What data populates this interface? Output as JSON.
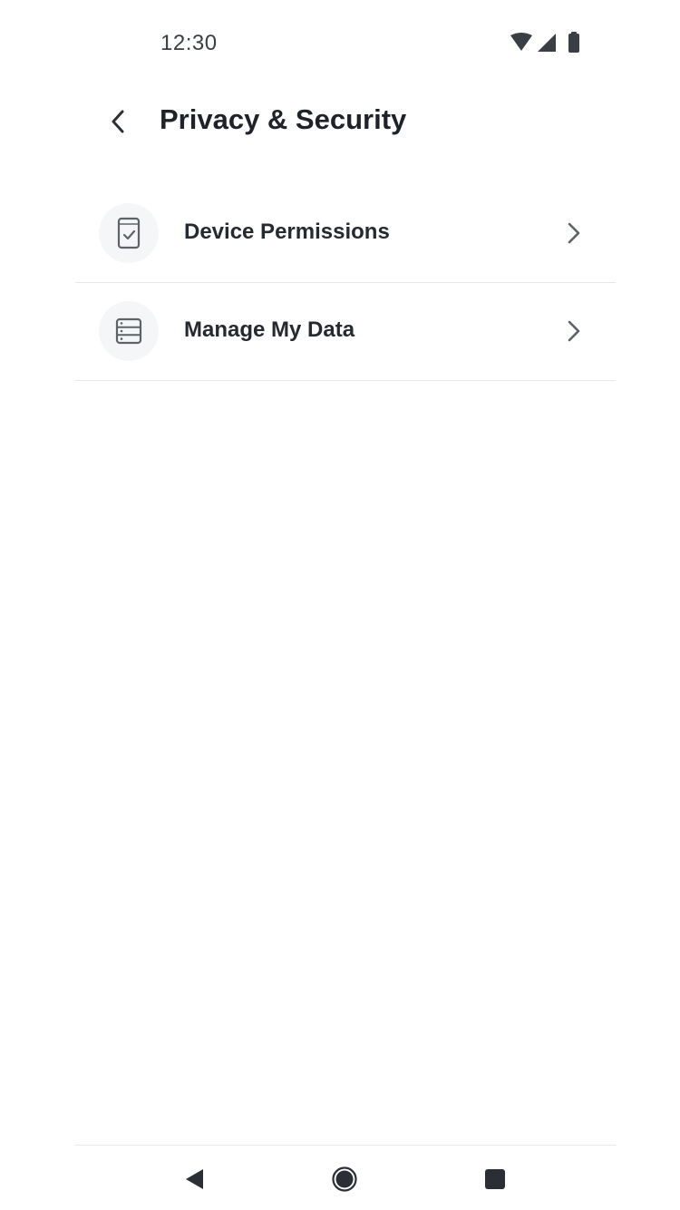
{
  "status_bar": {
    "time": "12:30",
    "icons": [
      "wifi-icon",
      "cellular-signal-icon",
      "battery-icon"
    ]
  },
  "header": {
    "back_icon": "chevron-left-icon",
    "title": "Privacy & Security"
  },
  "menu": {
    "items": [
      {
        "label": "Device Permissions",
        "icon": "phone-check-icon",
        "trailing_icon": "chevron-right-icon"
      },
      {
        "label": "Manage My Data",
        "icon": "data-list-icon",
        "trailing_icon": "chevron-right-icon"
      }
    ]
  },
  "nav_bar": {
    "buttons": [
      "back-triangle-icon",
      "home-circle-icon",
      "recents-square-icon"
    ]
  },
  "colors": {
    "text_primary": "#1f2329",
    "icon_gray": "#5f6368",
    "icon_bg": "#f4f6f8",
    "divider": "#e6e8ea",
    "nav_icon": "#2b2f35"
  }
}
